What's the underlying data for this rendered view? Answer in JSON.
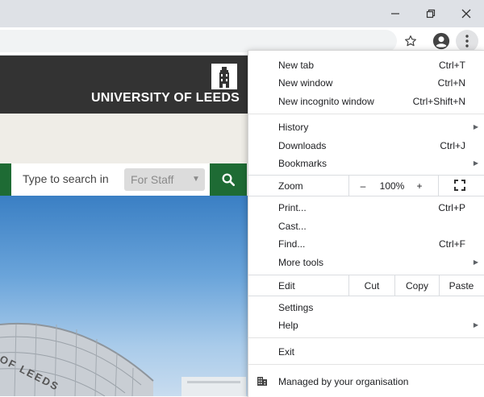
{
  "window": {
    "minimize_icon": "minimize-icon",
    "restore_icon": "restore-icon",
    "close_icon": "close-icon"
  },
  "toolbar": {
    "bookmark_icon": "star-icon",
    "profile_icon": "account-circle-icon",
    "menu_icon": "vertical-dots-icon"
  },
  "site": {
    "logo_text": "UNIVERSITY OF LEEDS",
    "search_placeholder": "Type to search in",
    "search_scope": "For Staff",
    "hero_sign_text": "OF LEEDS"
  },
  "menu": {
    "items_group1": [
      {
        "label": "New tab",
        "shortcut": "Ctrl+T"
      },
      {
        "label": "New window",
        "shortcut": "Ctrl+N"
      },
      {
        "label": "New incognito window",
        "shortcut": "Ctrl+Shift+N"
      }
    ],
    "items_group2": [
      {
        "label": "History",
        "shortcut": ""
      },
      {
        "label": "Downloads",
        "shortcut": "Ctrl+J"
      },
      {
        "label": "Bookmarks",
        "shortcut": ""
      }
    ],
    "zoom": {
      "label": "Zoom",
      "minus": "–",
      "value": "100%",
      "plus": "+"
    },
    "items_group3": [
      {
        "label": "Print...",
        "shortcut": "Ctrl+P"
      },
      {
        "label": "Cast...",
        "shortcut": ""
      },
      {
        "label": "Find...",
        "shortcut": "Ctrl+F"
      },
      {
        "label": "More tools",
        "shortcut": ""
      }
    ],
    "edit": {
      "label": "Edit",
      "cut": "Cut",
      "copy": "Copy",
      "paste": "Paste"
    },
    "items_group4": [
      {
        "label": "Settings"
      },
      {
        "label": "Help"
      }
    ],
    "exit": "Exit",
    "managed": "Managed by your organisation"
  },
  "colors": {
    "university_header": "#333333",
    "brand_green": "#1e6b34",
    "menu_text": "#202124"
  }
}
